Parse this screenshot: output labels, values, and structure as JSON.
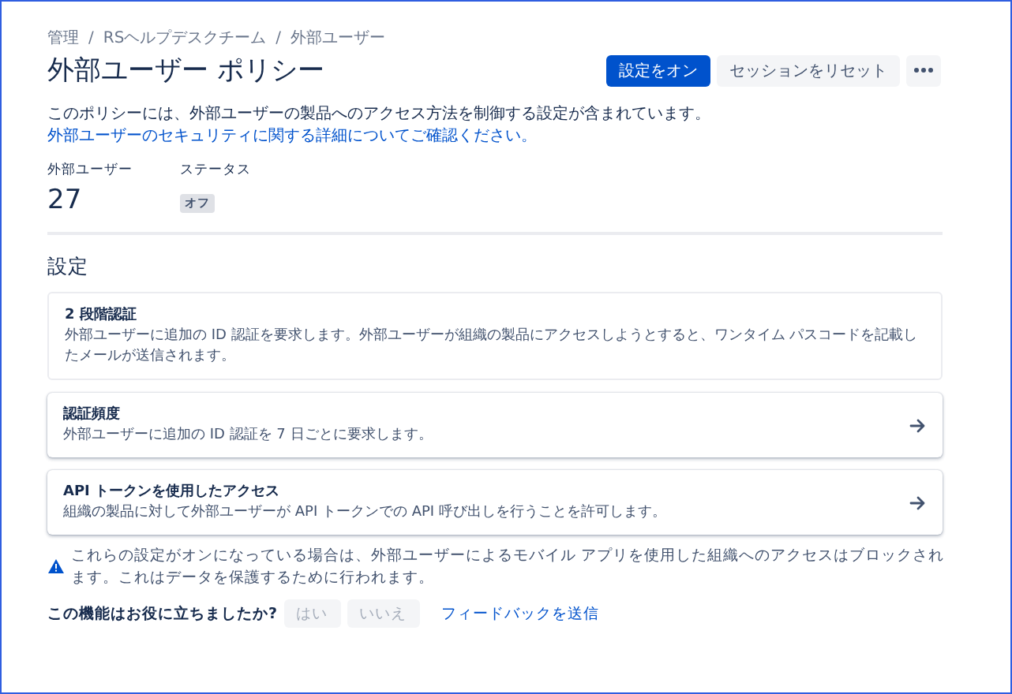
{
  "breadcrumbs": [
    {
      "label": "管理",
      "separator": "/"
    },
    {
      "label": "RSヘルプデスクチーム",
      "separator": "/"
    },
    {
      "label": "外部ユーザー"
    }
  ],
  "title": "外部ユーザー ポリシー",
  "actions": {
    "primary": "設定をオン",
    "secondary": "セッションをリセット"
  },
  "description": {
    "text": "このポリシーには、外部ユーザーの製品へのアクセス方法を制御する設定が含まれています。",
    "link": "外部ユーザーのセキュリティに関する詳細についてご確認ください。"
  },
  "stats": [
    {
      "label": "外部ユーザー",
      "kind": "number",
      "value": "27"
    },
    {
      "label": "ステータス",
      "kind": "badge",
      "value": "オフ"
    }
  ],
  "settings": {
    "heading": "設定",
    "items": [
      {
        "title": "2 段階認証",
        "description": "外部ユーザーに追加の ID 認証を要求します。外部ユーザーが組織の製品にアクセスしようとすると、ワンタイム パスコードを記載したメールが送信されます。",
        "navigable": false
      },
      {
        "title": "認証頻度",
        "description": "外部ユーザーに追加の ID 認証を 7 日ごとに要求します。",
        "navigable": true
      },
      {
        "title": "API トークンを使用したアクセス",
        "description": "組織の製品に対して外部ユーザーが API トークンでの API 呼び出しを行うことを許可します。",
        "navigable": true
      }
    ]
  },
  "warning": "これらの設定がオンになっている場合は、外部ユーザーによるモバイル アプリを使用した組織へのアクセスはブロックされます。これはデータを保護するために行われます。",
  "feedback": {
    "question": "この機能はお役に立ちましたか?",
    "yes": "はい",
    "no": "いいえ",
    "link": "フィードバックを送信"
  }
}
